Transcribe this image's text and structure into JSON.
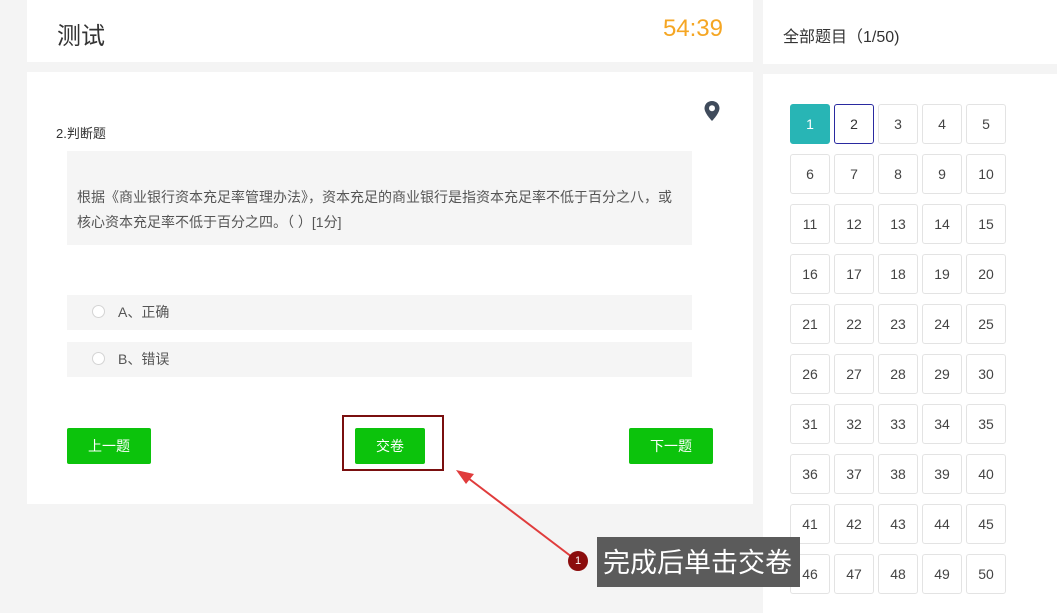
{
  "header": {
    "title": "测试",
    "timer": "54:39"
  },
  "question": {
    "type_label": "2.判断题",
    "text": "根据《商业银行资本充足率管理办法》，资本充足的商业银行是指资本充足率不低于百分之八，或核心资本充足率不低于百分之四。（    ）[1分]",
    "options": [
      {
        "label": "A、正确"
      },
      {
        "label": "B、错误"
      }
    ]
  },
  "buttons": {
    "prev": "上一题",
    "submit": "交卷",
    "next": "下一题"
  },
  "sidebar": {
    "header": "全部题目（1/50)",
    "numbers": [
      "1",
      "2",
      "3",
      "4",
      "5",
      "6",
      "7",
      "8",
      "9",
      "10",
      "11",
      "12",
      "13",
      "14",
      "15",
      "16",
      "17",
      "18",
      "19",
      "20",
      "21",
      "22",
      "23",
      "24",
      "25",
      "26",
      "27",
      "28",
      "29",
      "30",
      "31",
      "32",
      "33",
      "34",
      "35",
      "36",
      "37",
      "38",
      "39",
      "40",
      "41",
      "42",
      "43",
      "44",
      "45",
      "46",
      "47",
      "48",
      "49",
      "50"
    ],
    "answered_number": "1",
    "current_number": "2"
  },
  "annotation": {
    "badge": "1",
    "text": "完成后单击交卷"
  },
  "colors": {
    "timer": "#f5a623",
    "button": "#0cc30c",
    "answered": "#28b5b5",
    "current_border": "#2a2aa0",
    "annotation_red": "#8b0d0d"
  },
  "icons": {
    "location": "location-pin-icon"
  }
}
